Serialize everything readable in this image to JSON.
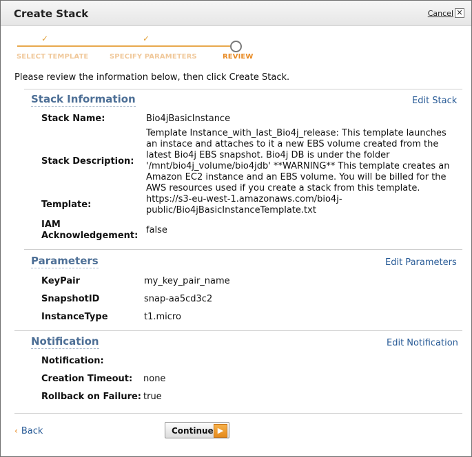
{
  "dialog": {
    "title": "Create Stack",
    "cancel_label": "Cancel",
    "close_glyph": "✕"
  },
  "wizard": {
    "steps": [
      {
        "label": "SELECT TEMPLATE",
        "state": "done"
      },
      {
        "label": "SPECIFY PARAMETERS",
        "state": "done"
      },
      {
        "label": "REVIEW",
        "state": "active"
      }
    ],
    "check_glyph": "✓"
  },
  "intro": "Please review the information below, then click Create Stack.",
  "stack_info": {
    "title": "Stack Information",
    "edit_label": "Edit Stack",
    "rows": [
      {
        "label": "Stack Name:",
        "value": "Bio4jBasicInstance"
      },
      {
        "label": "Stack Description:",
        "value_lines": [
          "Template Instance_with_last_Bio4j_release: This template launches",
          "an instace and attaches to it a new EBS volume created from the",
          "latest Bio4j EBS snapshot. Bio4j DB is under the folder",
          "'/mnt/bio4j_volume/bio4jdb' **WARNING** This template creates an",
          "Amazon EC2 instance and an EBS volume. You will be billed for the",
          "AWS resources used if you create a stack from this template."
        ]
      },
      {
        "label": "Template:",
        "value_lines": [
          "https://s3-eu-west-1.amazonaws.com/bio4j-",
          "public/Bio4jBasicInstanceTemplate.txt"
        ]
      },
      {
        "label_lines": [
          "IAM",
          "Acknowledgement:"
        ],
        "value": "false"
      }
    ]
  },
  "parameters": {
    "title": "Parameters",
    "edit_label": "Edit Parameters",
    "rows": [
      {
        "label": "KeyPair",
        "value": "my_key_pair_name"
      },
      {
        "label": "SnapshotID",
        "value": "snap-aa5cd3c2"
      },
      {
        "label": "InstanceType",
        "value": "t1.micro"
      }
    ]
  },
  "notification": {
    "title": "Notification",
    "edit_label": "Edit Notification",
    "rows": [
      {
        "label": "Notification:",
        "value": ""
      },
      {
        "label": "Creation Timeout:",
        "value": "none"
      },
      {
        "label": "Rollback on Failure:",
        "value": "true"
      }
    ]
  },
  "footer": {
    "back_label": "Back",
    "back_glyph": "‹",
    "continue_label": "Continue",
    "continue_glyph": "▶"
  },
  "colors": {
    "section_title": "#4d6f96",
    "link": "#275a96",
    "wizard_accent": "#e88a23"
  }
}
